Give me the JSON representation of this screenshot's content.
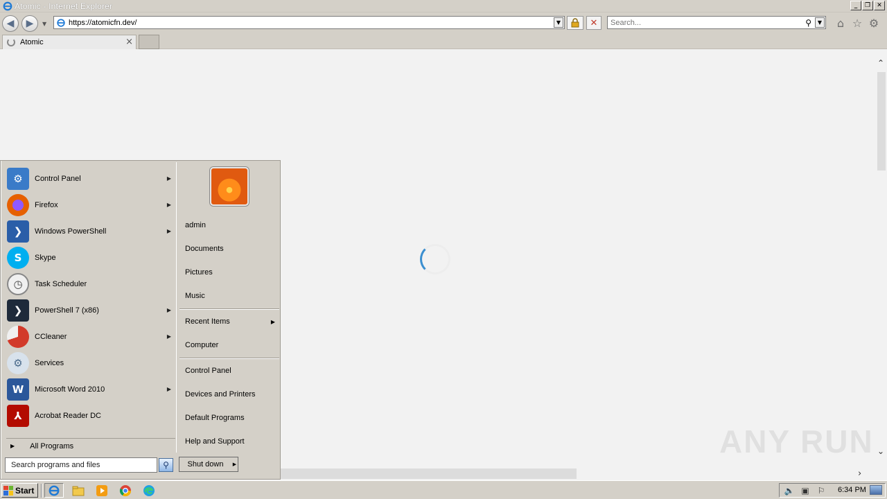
{
  "window": {
    "title": "Atomic - Internet Explorer",
    "controls": [
      "_",
      "❐",
      "✕"
    ]
  },
  "navbar": {
    "url": "https://atomicfn.dev/",
    "search_placeholder": "Search...",
    "icons": [
      "back-icon",
      "forward-icon",
      "lock-icon",
      "stop-icon",
      "search-icon",
      "home-icon",
      "favorites-icon",
      "gear-icon"
    ]
  },
  "tabs": [
    {
      "label": "Atomic",
      "loading": true
    }
  ],
  "content": {
    "loading_color": "#3b8fd0",
    "watermark": "ANY RUN"
  },
  "start_menu": {
    "programs": [
      {
        "label": "Control Panel",
        "icon": "control-panel-icon",
        "has_submenu": true,
        "color": "#3a7bc8"
      },
      {
        "label": "Firefox",
        "icon": "firefox-icon",
        "has_submenu": true,
        "color": "#e66000"
      },
      {
        "label": "Windows PowerShell",
        "icon": "powershell-icon",
        "has_submenu": true,
        "color": "#2a5ea8"
      },
      {
        "label": "Skype",
        "icon": "skype-icon",
        "has_submenu": false,
        "color": "#00aff0"
      },
      {
        "label": "Task Scheduler",
        "icon": "task-scheduler-icon",
        "has_submenu": false,
        "color": "#c8c8c8"
      },
      {
        "label": "PowerShell 7 (x86)",
        "icon": "powershell7-icon",
        "has_submenu": true,
        "color": "#1e2a3a"
      },
      {
        "label": "CCleaner",
        "icon": "ccleaner-icon",
        "has_submenu": true,
        "color": "#d23a2a"
      },
      {
        "label": "Services",
        "icon": "services-icon",
        "has_submenu": false,
        "color": "#8aa8c8"
      },
      {
        "label": "Microsoft Word 2010",
        "icon": "word-icon",
        "has_submenu": true,
        "color": "#2b579a"
      },
      {
        "label": "Acrobat Reader DC",
        "icon": "acrobat-icon",
        "has_submenu": false,
        "color": "#b30b00"
      }
    ],
    "all_programs": "All Programs",
    "search_placeholder": "Search programs and files",
    "right": {
      "user": "admin",
      "group1": [
        "Documents",
        "Pictures",
        "Music"
      ],
      "recent_items": "Recent Items",
      "computer": "Computer",
      "group3": [
        "Control Panel",
        "Devices and Printers",
        "Default Programs",
        "Help and Support"
      ]
    },
    "shutdown": "Shut down"
  },
  "taskbar": {
    "start_label": "Start",
    "apps": [
      "ie-icon",
      "explorer-icon",
      "media-player-icon",
      "chrome-icon",
      "edge-icon"
    ],
    "clock": "6:34 PM",
    "tray_icons": [
      "volume-icon",
      "network-icon",
      "action-center-flag-icon"
    ]
  }
}
